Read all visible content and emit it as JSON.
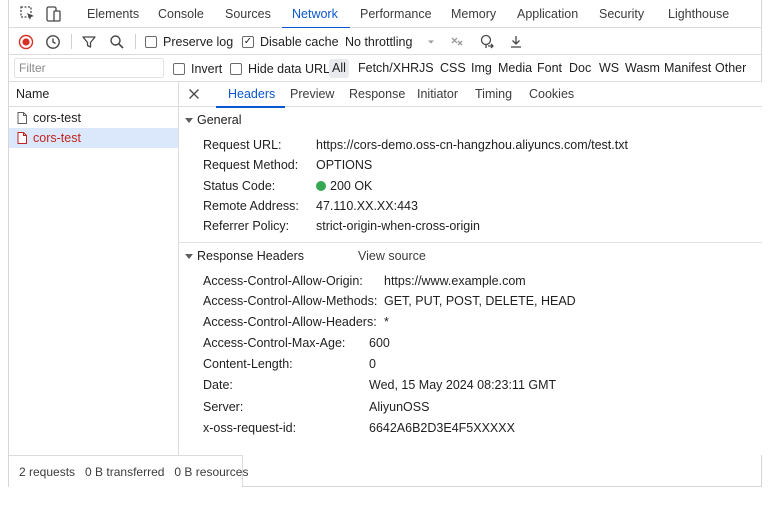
{
  "top_tabs": [
    "Elements",
    "Console",
    "Sources",
    "Network",
    "Performance",
    "Memory",
    "Application",
    "Security",
    "Lighthouse"
  ],
  "active_tab": "Network",
  "toolbar": {
    "preserve_log": "Preserve log",
    "disable_cache": "Disable cache",
    "throttling": "No throttling"
  },
  "filter": {
    "placeholder": "Filter",
    "invert": "Invert",
    "hide_data_urls": "Hide data URLs",
    "types": [
      "All",
      "Fetch/XHR",
      "JS",
      "CSS",
      "Img",
      "Media",
      "Font",
      "Doc",
      "WS",
      "Wasm",
      "Manifest",
      "Other"
    ]
  },
  "request_list": {
    "header": "Name",
    "rows": [
      "cors-test",
      "cors-test"
    ]
  },
  "detail_tabs": [
    "Headers",
    "Preview",
    "Response",
    "Initiator",
    "Timing",
    "Cookies"
  ],
  "general": {
    "title": "General",
    "rows": [
      {
        "key": "Request URL:",
        "value": "https://cors-demo.oss-cn-hangzhou.aliyuncs.com/test.txt"
      },
      {
        "key": "Request Method:",
        "value": "OPTIONS"
      },
      {
        "key": "Status Code:",
        "value": "200 OK"
      },
      {
        "key": "Remote Address:",
        "value": "47.110.XX.XX:443"
      },
      {
        "key": "Referrer Policy:",
        "value": "strict-origin-when-cross-origin"
      }
    ]
  },
  "response_headers": {
    "title": "Response Headers",
    "view_source": "View source",
    "rows": [
      {
        "key": "Access-Control-Allow-Origin:",
        "value": "https://www.example.com"
      },
      {
        "key": "Access-Control-Allow-Methods:",
        "value": "GET, PUT, POST, DELETE, HEAD"
      },
      {
        "key": "Access-Control-Allow-Headers:",
        "value": "*"
      },
      {
        "key": "Access-Control-Max-Age:",
        "value": "600"
      },
      {
        "key": "Content-Length:",
        "value": "0"
      },
      {
        "key": "Date:",
        "value": "Wed, 15 May 2024 08:23:11 GMT"
      },
      {
        "key": "Server:",
        "value": "AliyunOSS"
      },
      {
        "key": "x-oss-request-id:",
        "value": "6642A6B2D3E4F5XXXXX"
      }
    ]
  },
  "status_bar": {
    "requests": "2 requests",
    "transferred": "0 B transferred",
    "resources": "0 B resources"
  },
  "colors": {
    "accent": "#0b57d0",
    "record": "#d93025",
    "status_ok": "#34a853",
    "selected_row_bg": "#dbe8fb",
    "selected_row_text": "#c5221f"
  }
}
